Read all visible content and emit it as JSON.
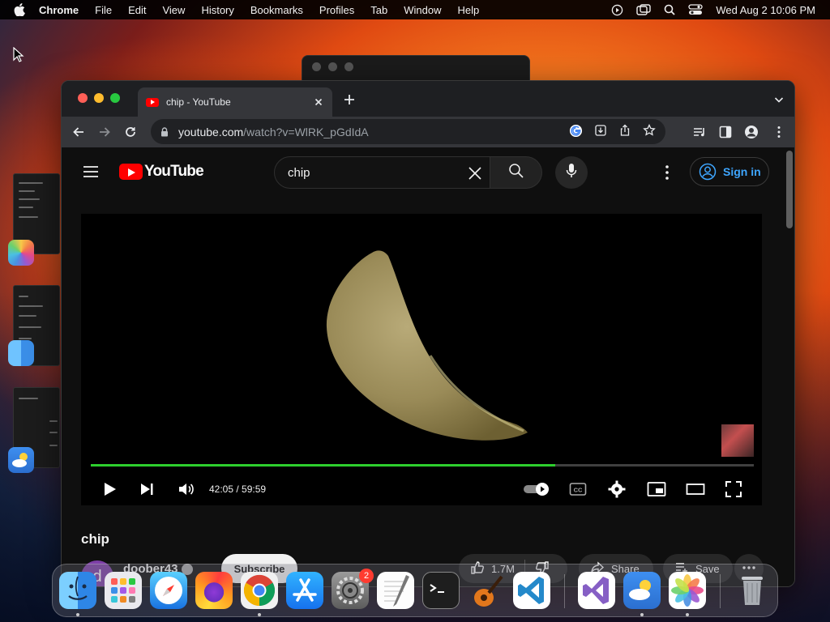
{
  "menubar": {
    "app_name": "Chrome",
    "items": [
      "File",
      "Edit",
      "View",
      "History",
      "Bookmarks",
      "Profiles",
      "Tab",
      "Window",
      "Help"
    ],
    "clock": "Wed Aug 2  10:06 PM",
    "status_icons": [
      "play-circle-icon",
      "screen-mirror-icon",
      "spotlight-search-icon",
      "control-center-icon"
    ]
  },
  "browser": {
    "tab": {
      "title": "chip - YouTube",
      "favicon": "youtube-favicon-icon"
    },
    "url_host": "youtube.com",
    "url_path": "/watch?v=WlRK_pGdIdA",
    "colors": {
      "tabstrip": "#1e1f22",
      "toolbar": "#35363a",
      "omnibox": "#202124"
    }
  },
  "youtube": {
    "logo_text": "YouTube",
    "search": {
      "query": "chip"
    },
    "sign_in_label": "Sign in",
    "player": {
      "time_current": "42:05",
      "time_total": "59:59",
      "time_display": "42:05 / 59:59",
      "progress": 0.7,
      "progress_color": "#2dcf2d"
    },
    "video_title": "chip",
    "channel": {
      "avatar_letter": "d",
      "name": "doober43",
      "subscribe_label": "Subscribe"
    },
    "actions": {
      "likes": "1.7M",
      "share": "Share",
      "save": "Save"
    }
  },
  "dock": {
    "apps": [
      {
        "name": "Finder",
        "icon": "finder-icon",
        "running": true
      },
      {
        "name": "Launchpad",
        "icon": "launchpad-icon",
        "running": false
      },
      {
        "name": "Safari",
        "icon": "safari-icon",
        "running": false
      },
      {
        "name": "Firefox",
        "icon": "firefox-icon",
        "running": false
      },
      {
        "name": "Chrome",
        "icon": "chrome-icon",
        "running": true
      },
      {
        "name": "App Store",
        "icon": "app-store-icon",
        "running": false
      },
      {
        "name": "System Settings",
        "icon": "settings-icon",
        "running": false,
        "badge": "2"
      },
      {
        "name": "TextEdit",
        "icon": "textedit-icon",
        "running": false
      },
      {
        "name": "Terminal",
        "icon": "terminal-icon",
        "running": false
      },
      {
        "name": "GarageBand",
        "icon": "garageband-icon",
        "running": false
      },
      {
        "name": "Visual Studio Code",
        "icon": "vscode-icon",
        "running": false
      },
      {
        "name": "Visual Studio",
        "icon": "visual-studio-icon",
        "running": false
      },
      {
        "name": "Weather",
        "icon": "weather-icon",
        "running": true
      },
      {
        "name": "Photos",
        "icon": "photos-icon",
        "running": true
      },
      {
        "name": "Trash",
        "icon": "trash-icon",
        "running": false
      }
    ]
  }
}
